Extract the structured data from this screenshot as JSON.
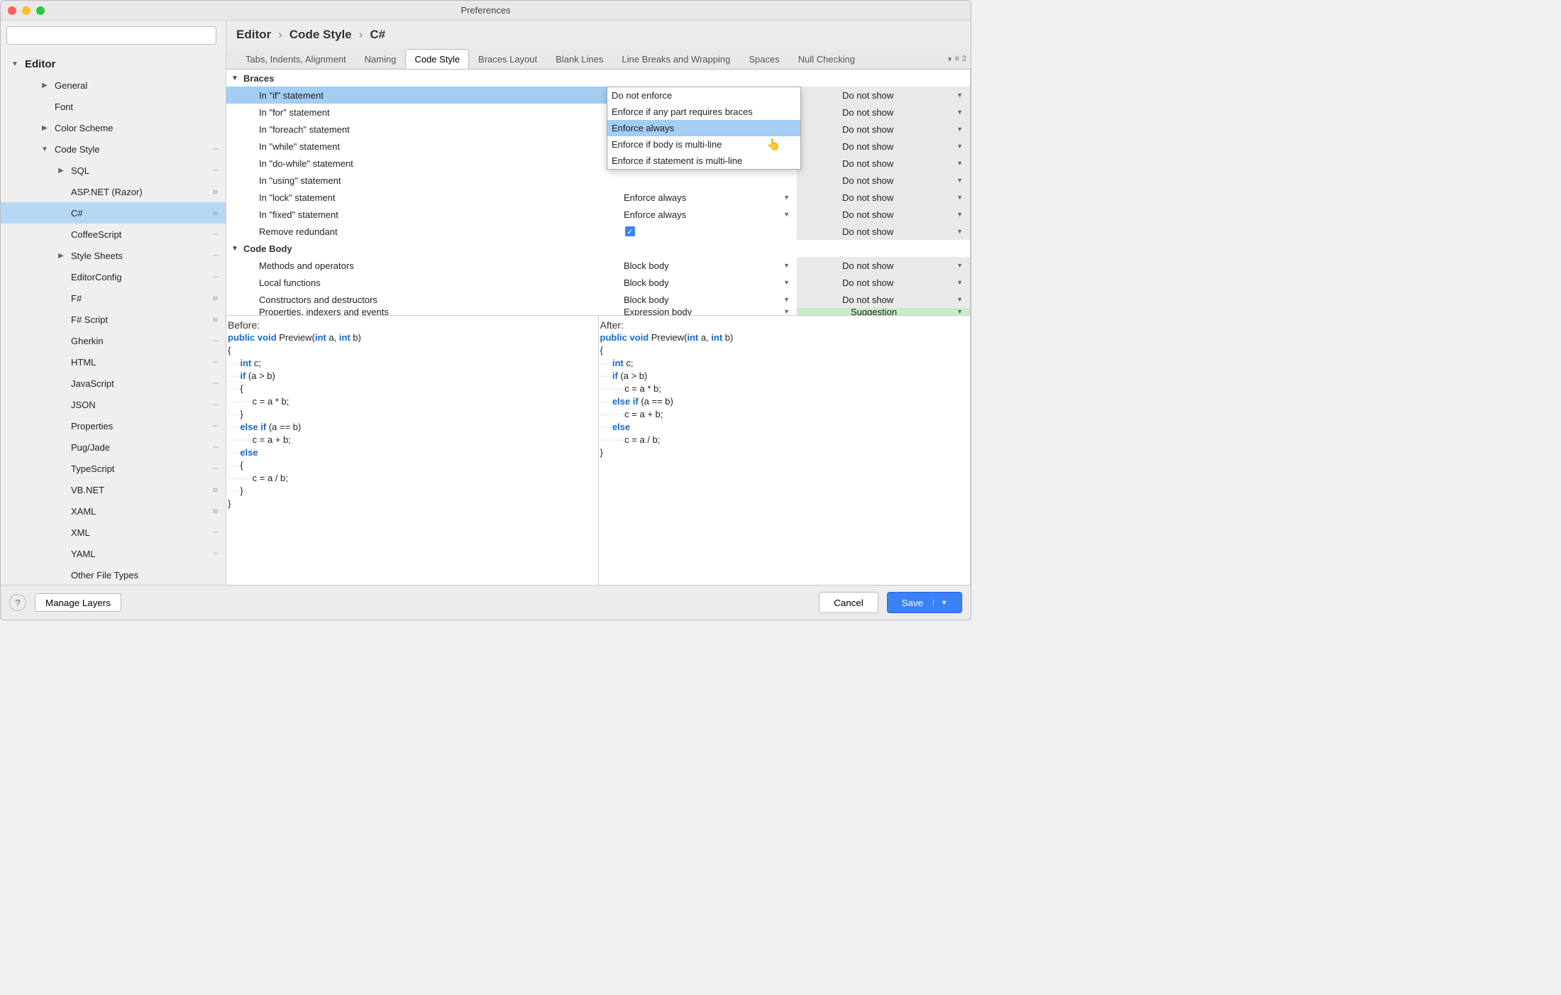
{
  "window_title": "Preferences",
  "search_placeholder": "",
  "sidebar": [
    {
      "level": 1,
      "disclosure": "down",
      "label": "Editor"
    },
    {
      "level": 2,
      "disclosure": "right",
      "label": "General"
    },
    {
      "level": 2,
      "disclosure": "none",
      "label": "Font"
    },
    {
      "level": 2,
      "disclosure": "right",
      "label": "Color Scheme"
    },
    {
      "level": 2,
      "disclosure": "down",
      "label": "Code Style",
      "tail": "layer"
    },
    {
      "level": 3,
      "disclosure": "right",
      "label": "SQL",
      "tail": "layer"
    },
    {
      "level": 3,
      "disclosure": "none",
      "label": "ASP.NET (Razor)",
      "tail": "layers"
    },
    {
      "level": 3,
      "disclosure": "none",
      "label": "C#",
      "selected": true,
      "tail": "layers"
    },
    {
      "level": 3,
      "disclosure": "none",
      "label": "CoffeeScript",
      "tail": "layer"
    },
    {
      "level": 3,
      "disclosure": "right",
      "label": "Style Sheets",
      "tail": "layer"
    },
    {
      "level": 3,
      "disclosure": "none",
      "label": "EditorConfig",
      "tail": "layer"
    },
    {
      "level": 3,
      "disclosure": "none",
      "label": "F#",
      "tail": "layers"
    },
    {
      "level": 3,
      "disclosure": "none",
      "label": "F# Script",
      "tail": "layers"
    },
    {
      "level": 3,
      "disclosure": "none",
      "label": "Gherkin",
      "tail": "layer"
    },
    {
      "level": 3,
      "disclosure": "none",
      "label": "HTML",
      "tail": "layer"
    },
    {
      "level": 3,
      "disclosure": "none",
      "label": "JavaScript",
      "tail": "layer"
    },
    {
      "level": 3,
      "disclosure": "none",
      "label": "JSON",
      "tail": "layer"
    },
    {
      "level": 3,
      "disclosure": "none",
      "label": "Properties",
      "tail": "layer"
    },
    {
      "level": 3,
      "disclosure": "none",
      "label": "Pug/Jade",
      "tail": "layer"
    },
    {
      "level": 3,
      "disclosure": "none",
      "label": "TypeScript",
      "tail": "layer"
    },
    {
      "level": 3,
      "disclosure": "none",
      "label": "VB.NET",
      "tail": "layers"
    },
    {
      "level": 3,
      "disclosure": "none",
      "label": "XAML",
      "tail": "layers"
    },
    {
      "level": 3,
      "disclosure": "none",
      "label": "XML",
      "tail": "layer"
    },
    {
      "level": 3,
      "disclosure": "none",
      "label": "YAML",
      "tail": "layer"
    },
    {
      "level": 3,
      "disclosure": "none",
      "label": "Other File Types"
    }
  ],
  "breadcrumb": [
    "Editor",
    "Code Style",
    "C#"
  ],
  "tabs": [
    "Tabs, Indents, Alignment",
    "Naming",
    "Code Style",
    "Braces Layout",
    "Blank Lines",
    "Line Breaks and Wrapping",
    "Spaces",
    "Null Checking"
  ],
  "active_tab": "Code Style",
  "tabstrip_tail_count": "2",
  "sections": [
    {
      "title": "Braces",
      "rows": [
        {
          "name": "In \"if\" statement",
          "combo": "Enforce if any part requir…",
          "severity": "Do not show",
          "selected": true,
          "popup": true
        },
        {
          "name": "In \"for\" statement",
          "combo": "",
          "severity": "Do not show"
        },
        {
          "name": "In \"foreach\" statement",
          "combo": "",
          "severity": "Do not show"
        },
        {
          "name": "In \"while\" statement",
          "combo": "",
          "severity": "Do not show"
        },
        {
          "name": "In \"do-while\" statement",
          "combo": "",
          "severity": "Do not show"
        },
        {
          "name": "In \"using\" statement",
          "combo": "",
          "severity": "Do not show"
        },
        {
          "name": "In \"lock\" statement",
          "combo": "Enforce always",
          "severity": "Do not show"
        },
        {
          "name": "In \"fixed\" statement",
          "combo": "Enforce always",
          "severity": "Do not show"
        },
        {
          "name": "Remove redundant",
          "checkbox": true,
          "severity": "Do not show"
        }
      ]
    },
    {
      "title": "Code Body",
      "rows": [
        {
          "name": "Methods and operators",
          "combo": "Block body",
          "severity": "Do not show"
        },
        {
          "name": "Local functions",
          "combo": "Block body",
          "severity": "Do not show"
        },
        {
          "name": "Constructors and destructors",
          "combo": "Block body",
          "severity": "Do not show"
        },
        {
          "name": "Properties, indexers and events",
          "combo": "Expression body",
          "severity": "Suggestion",
          "severity_class": "green",
          "clipped": true
        }
      ]
    }
  ],
  "popup_options": [
    "Do not enforce",
    "Enforce if any part requires braces",
    "Enforce always",
    "Enforce if body is multi-line",
    "Enforce if statement is multi-line"
  ],
  "popup_hover": "Enforce always",
  "preview": {
    "before_label": "Before:",
    "after_label": "After:",
    "before_lines": [
      {
        "indent": 0,
        "tokens": [
          {
            "t": "public",
            "k": true
          },
          {
            "t": " "
          },
          {
            "t": "void",
            "k": true
          },
          {
            "t": " Preview("
          },
          {
            "t": "int",
            "k": true
          },
          {
            "t": " a, "
          },
          {
            "t": "int",
            "k": true
          },
          {
            "t": " b)"
          }
        ]
      },
      {
        "indent": 0,
        "tokens": [
          {
            "t": "{"
          }
        ]
      },
      {
        "indent": 1,
        "tokens": [
          {
            "t": "int",
            "k": true
          },
          {
            "t": " c;"
          }
        ]
      },
      {
        "indent": 1,
        "tokens": [
          {
            "t": "if",
            "k": true
          },
          {
            "t": " (a > b)"
          }
        ]
      },
      {
        "indent": 1,
        "tokens": [
          {
            "t": "{"
          }
        ]
      },
      {
        "indent": 2,
        "tokens": [
          {
            "t": "c = a * b;"
          }
        ]
      },
      {
        "indent": 1,
        "tokens": [
          {
            "t": "}"
          }
        ]
      },
      {
        "indent": 1,
        "tokens": [
          {
            "t": "else",
            "k": true
          },
          {
            "t": " "
          },
          {
            "t": "if",
            "k": true
          },
          {
            "t": " (a == b)"
          }
        ]
      },
      {
        "indent": 2,
        "tokens": [
          {
            "t": "c = a + b;"
          }
        ]
      },
      {
        "indent": 1,
        "tokens": [
          {
            "t": "else",
            "k": true
          }
        ]
      },
      {
        "indent": 1,
        "tokens": [
          {
            "t": "{"
          }
        ]
      },
      {
        "indent": 2,
        "tokens": [
          {
            "t": "c = a / b;"
          }
        ]
      },
      {
        "indent": 1,
        "tokens": [
          {
            "t": "}"
          }
        ]
      },
      {
        "indent": 0,
        "tokens": [
          {
            "t": "}"
          }
        ]
      }
    ],
    "after_lines": [
      {
        "indent": 0,
        "tokens": [
          {
            "t": "public",
            "k": true
          },
          {
            "t": " "
          },
          {
            "t": "void",
            "k": true
          },
          {
            "t": " Preview("
          },
          {
            "t": "int",
            "k": true
          },
          {
            "t": " a, "
          },
          {
            "t": "int",
            "k": true
          },
          {
            "t": " b)"
          }
        ]
      },
      {
        "indent": 0,
        "tokens": [
          {
            "t": "{"
          }
        ]
      },
      {
        "indent": 1,
        "tokens": [
          {
            "t": "int",
            "k": true
          },
          {
            "t": " c;"
          }
        ]
      },
      {
        "indent": 1,
        "tokens": [
          {
            "t": "if",
            "k": true
          },
          {
            "t": " (a > b)"
          }
        ]
      },
      {
        "indent": 2,
        "tokens": [
          {
            "t": "c = a * b;"
          }
        ]
      },
      {
        "indent": 1,
        "tokens": [
          {
            "t": "else",
            "k": true
          },
          {
            "t": " "
          },
          {
            "t": "if",
            "k": true
          },
          {
            "t": " (a == b)"
          }
        ]
      },
      {
        "indent": 2,
        "tokens": [
          {
            "t": "c = a + b;"
          }
        ]
      },
      {
        "indent": 1,
        "tokens": [
          {
            "t": "else",
            "k": true
          }
        ]
      },
      {
        "indent": 2,
        "tokens": [
          {
            "t": "c = a / b;"
          }
        ]
      },
      {
        "indent": 0,
        "tokens": [
          {
            "t": "}"
          }
        ]
      }
    ]
  },
  "footer": {
    "help": "?",
    "manage": "Manage Layers",
    "cancel": "Cancel",
    "save": "Save"
  }
}
